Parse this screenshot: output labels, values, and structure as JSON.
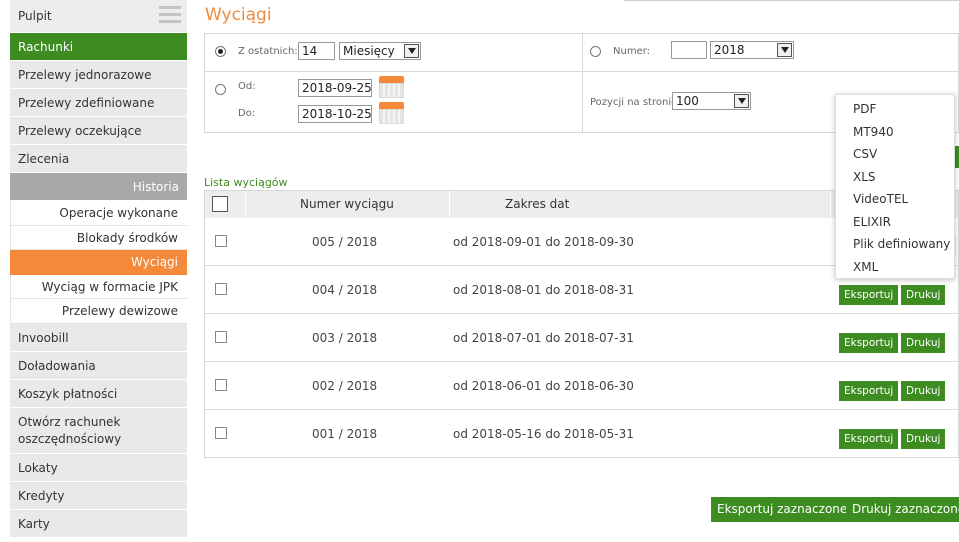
{
  "sidebar": {
    "items": [
      {
        "label": "Pulpit"
      },
      {
        "label": "Rachunki"
      },
      {
        "label": "Przelewy jednorazowe"
      },
      {
        "label": "Przelewy zdefiniowane"
      },
      {
        "label": "Przelewy oczekujące"
      },
      {
        "label": "Zlecenia"
      },
      {
        "label": "Historia"
      }
    ],
    "subitems": [
      {
        "label": "Operacje wykonane"
      },
      {
        "label": "Blokady środków"
      },
      {
        "label": "Wyciągi"
      },
      {
        "label": "Wyciąg w formacie JPK"
      },
      {
        "label": "Przelewy dewizowe"
      }
    ],
    "items_after": [
      {
        "label": "Invoobill"
      },
      {
        "label": "Doładowania"
      },
      {
        "label": "Koszyk płatności"
      },
      {
        "label_line1": "Otwórz rachunek",
        "label_line2": "oszczędnościowy"
      },
      {
        "label": "Lokaty"
      },
      {
        "label": "Kredyty"
      },
      {
        "label": "Karty"
      }
    ]
  },
  "page": {
    "title": "Wyciągi"
  },
  "filter": {
    "last_label": "Z ostatnich:",
    "last_value": "14",
    "last_unit": "Miesięcy",
    "number_label": "Numer:",
    "number_value": "",
    "number_year": "2018",
    "from_label": "Od:",
    "from_value": "2018-09-25",
    "to_label": "Do:",
    "to_value": "2018-10-25",
    "per_page_label": "Pozycji na stronie:",
    "per_page_value": "100"
  },
  "list": {
    "title": "Lista wyciągów",
    "col_number": "Numer wyciągu",
    "col_range": "Zakres dat",
    "rows": [
      {
        "number": "005 / 2018",
        "range": "od 2018-09-01 do 2018-09-30"
      },
      {
        "number": "004 / 2018",
        "range": "od 2018-08-01 do 2018-08-31"
      },
      {
        "number": "003 / 2018",
        "range": "od 2018-07-01 do 2018-07-31"
      },
      {
        "number": "002 / 2018",
        "range": "od 2018-06-01 do 2018-06-30"
      },
      {
        "number": "001 / 2018",
        "range": "od 2018-05-16 do 2018-05-31"
      }
    ],
    "export_label": "Eksportuj",
    "print_label": "Drukuj"
  },
  "footer": {
    "export_selected": "Eksportuj zaznaczone",
    "print_selected": "Drukuj zaznaczone"
  },
  "export_menu": {
    "items": [
      "PDF",
      "MT940",
      "CSV",
      "XLS",
      "VideoTEL",
      "ELIXIR",
      "Plik definiowany",
      "XML"
    ]
  }
}
